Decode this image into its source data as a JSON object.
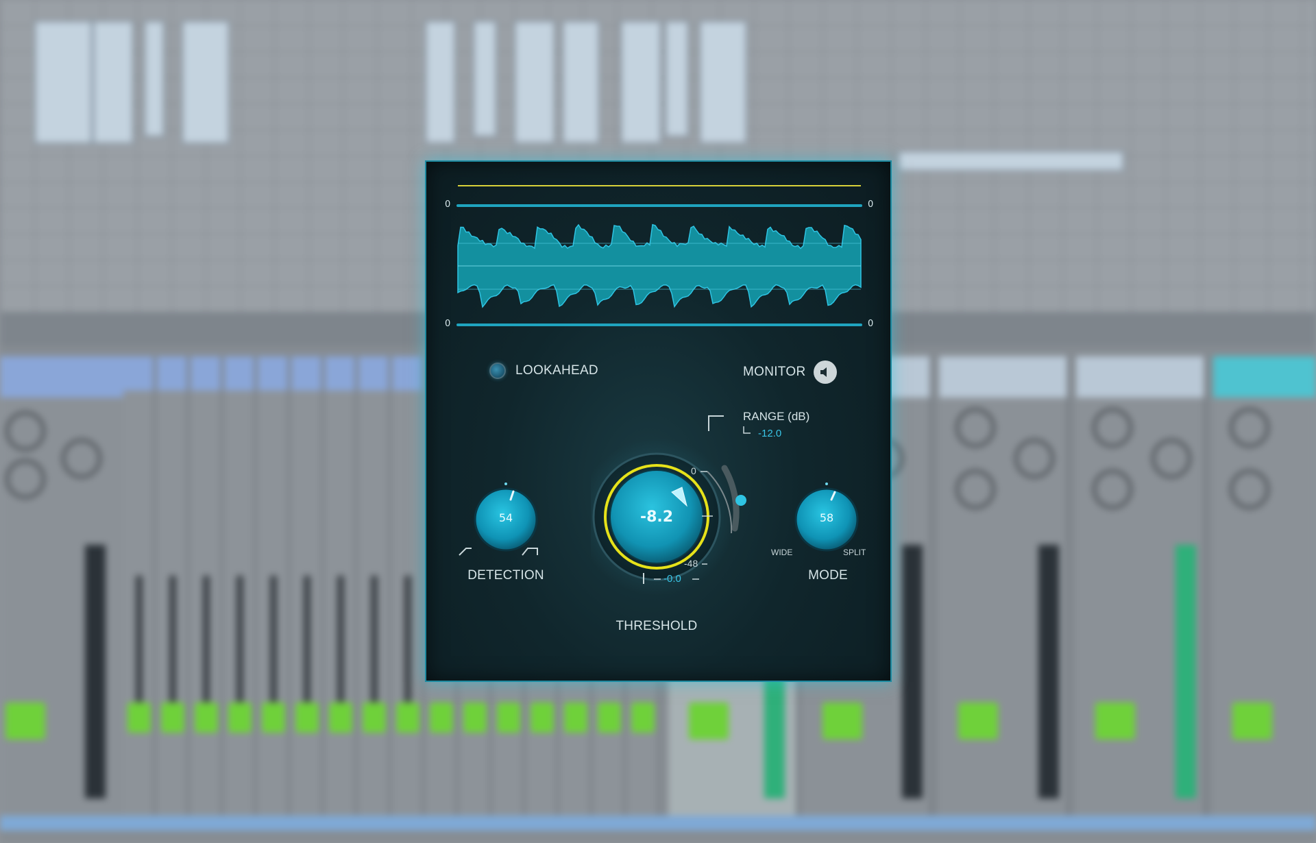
{
  "plugin": {
    "waveform": {
      "top_left_label": "0",
      "top_right_label": "0",
      "bottom_left_label": "0",
      "bottom_right_label": "0"
    },
    "lookahead": {
      "label": "LOOKAHEAD"
    },
    "monitor": {
      "label": "MONITOR",
      "icon": "speaker-icon"
    },
    "range": {
      "title": "RANGE (dB)",
      "value": "-12.0"
    },
    "threshold": {
      "label": "THRESHOLD",
      "value": "-8.2",
      "scale_top": "0",
      "scale_bottom": "-48",
      "offset": "-0.0"
    },
    "detection": {
      "label": "DETECTION",
      "value": "54"
    },
    "mode": {
      "label": "MODE",
      "value": "58",
      "left_label": "WIDE",
      "right_label": "SPLIT"
    }
  },
  "colors": {
    "accent": "#2fc4e3",
    "threshold_ring": "#e6e21a",
    "panel_bg": "#10262c",
    "waveform": "#13909f"
  }
}
